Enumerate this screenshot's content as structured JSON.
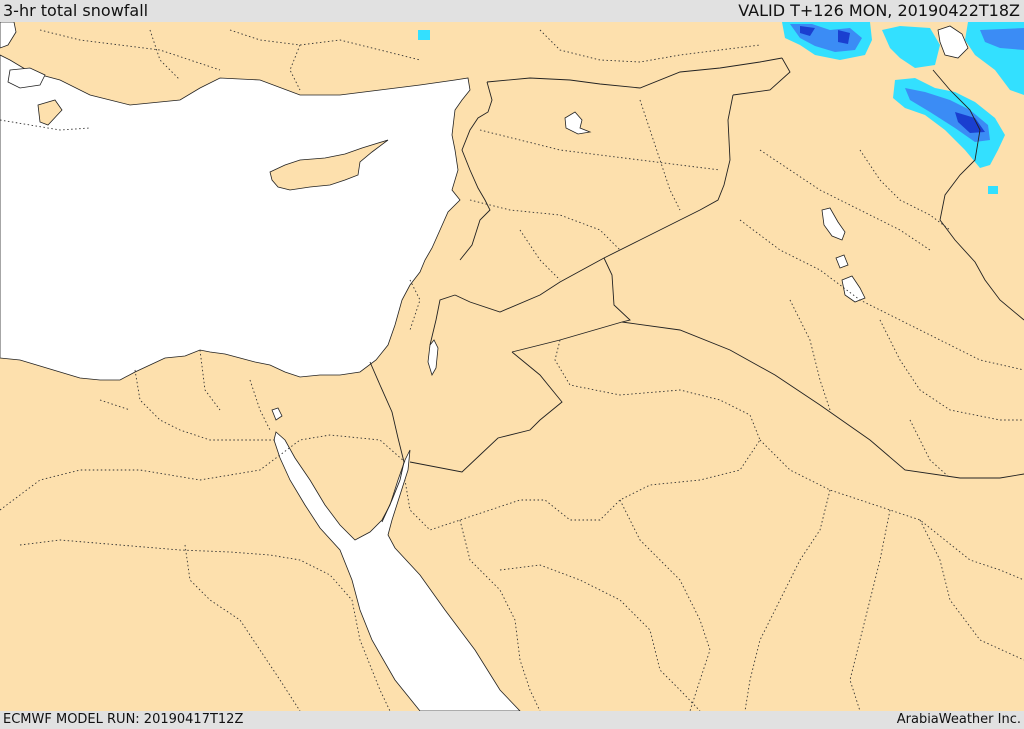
{
  "header": {
    "title": "3-hr total snowfall",
    "valid": "VALID T+126 MON, 20190422T18Z"
  },
  "footer": {
    "model_run": "ECMWF MODEL RUN: 20190417T12Z",
    "credit": "ArabiaWeather Inc."
  },
  "map": {
    "land_color": "#fde0ad",
    "water_color": "#ffffff",
    "border_color": "#222222",
    "snow_colors": {
      "light": "#33e0ff",
      "medium": "#3b8cf5",
      "heavy": "#1a3fd0"
    }
  }
}
